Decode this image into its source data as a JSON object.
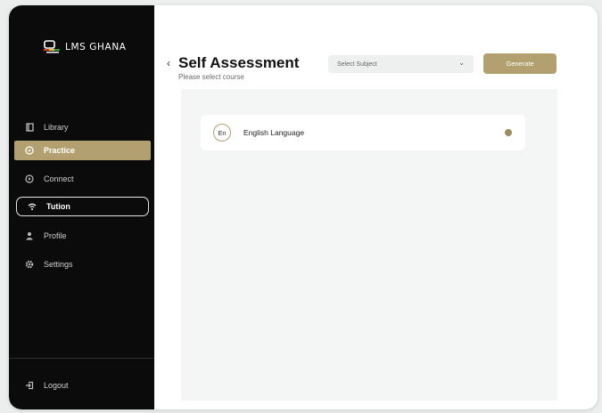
{
  "brand": {
    "name": "LMS GHANA"
  },
  "colors": {
    "accent": "#b3a070",
    "sidebar": "#0b0b0b",
    "panel": "#f4f6f6"
  },
  "sidebar": {
    "items": [
      {
        "label": "Library",
        "icon": "book-icon"
      },
      {
        "label": "Practice",
        "icon": "compass-icon",
        "state": "active"
      },
      {
        "label": "Connect",
        "icon": "play-icon"
      },
      {
        "label": "Tution",
        "icon": "wifi-icon",
        "state": "outlined"
      },
      {
        "label": "Profile",
        "icon": "user-icon"
      },
      {
        "label": "Settings",
        "icon": "gear-icon"
      }
    ],
    "logout": {
      "label": "Logout",
      "icon": "logout-icon"
    }
  },
  "header": {
    "back_icon": "chevron-left-icon",
    "title": "Self Assessment",
    "subtitle": "Please select course",
    "select": {
      "placeholder": "Select Subject",
      "icon": "chevron-down-icon"
    },
    "generate_label": "Generate"
  },
  "courses": [
    {
      "badge": "En",
      "label": "English Language"
    }
  ]
}
